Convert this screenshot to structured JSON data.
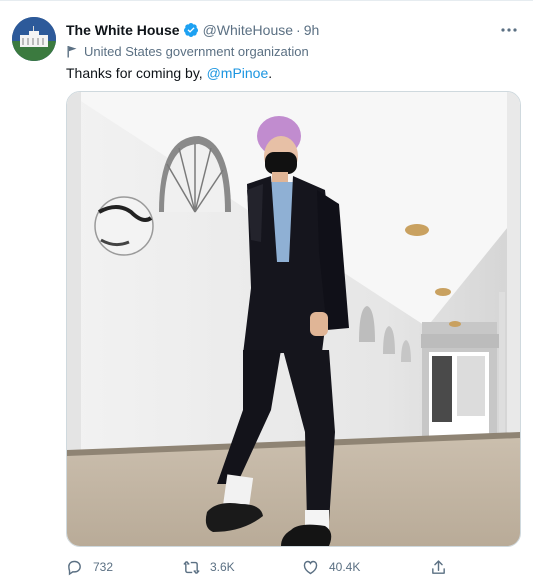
{
  "tweet": {
    "display_name": "The White House",
    "handle": "@WhiteHouse",
    "separator": "·",
    "time": "9h",
    "account_label": "United States government organization",
    "text_prefix": "Thanks for coming by, ",
    "mention": "@mPinoe",
    "text_suffix": ".",
    "accent_color": "#1b95e0",
    "verified_icon": "verified-badge-icon",
    "media_type": "video"
  },
  "actions": {
    "reply_count": "732",
    "retweet_count": "3.6K",
    "like_count": "40.4K",
    "share_icon": "share-icon"
  }
}
